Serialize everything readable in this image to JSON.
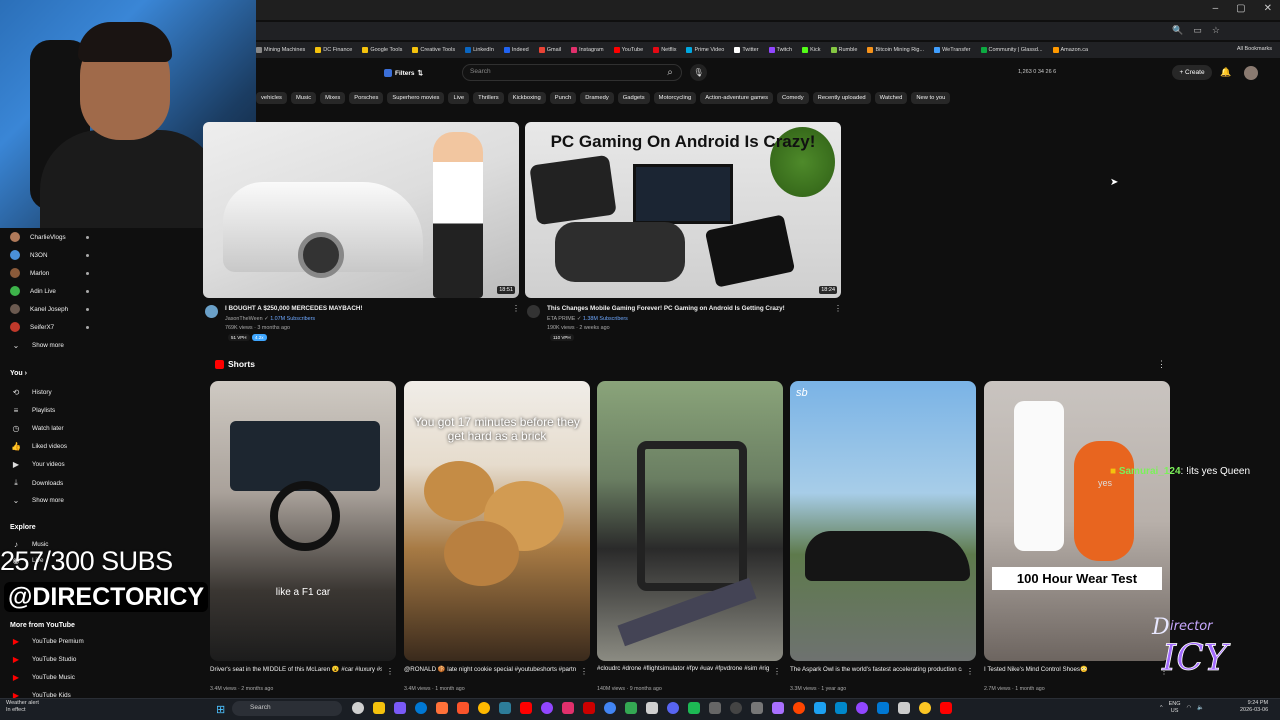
{
  "browser": {
    "window_controls": [
      "–",
      "▢",
      "✕"
    ],
    "bookmarks": [
      {
        "label": "Mining Machines",
        "color": "#888888"
      },
      {
        "label": "DC Finance",
        "color": "#f4c20d"
      },
      {
        "label": "Google Tools",
        "color": "#f4c20d"
      },
      {
        "label": "Creative Tools",
        "color": "#f4c20d"
      },
      {
        "label": "LinkedIn",
        "color": "#0a66c2"
      },
      {
        "label": "Indeed",
        "color": "#2164f3"
      },
      {
        "label": "Gmail",
        "color": "#ea4335"
      },
      {
        "label": "Instagram",
        "color": "#e1306c"
      },
      {
        "label": "YouTube",
        "color": "#ff0000"
      },
      {
        "label": "Netflix",
        "color": "#e50914"
      },
      {
        "label": "Prime Video",
        "color": "#00a8e1"
      },
      {
        "label": "Twitter",
        "color": "#ffffff"
      },
      {
        "label": "Twitch",
        "color": "#9146ff"
      },
      {
        "label": "Kick",
        "color": "#53fc18"
      },
      {
        "label": "Rumble",
        "color": "#85c742"
      },
      {
        "label": "Bitcoin Mining Rig...",
        "color": "#f7931a"
      },
      {
        "label": "WeTransfer",
        "color": "#409fff"
      },
      {
        "label": "Community | Glassd...",
        "color": "#0caa41"
      },
      {
        "label": "Amazon.ca",
        "color": "#ff9900"
      }
    ],
    "all_bookmarks": "All Bookmarks"
  },
  "topbar": {
    "filters": "Filters",
    "search_placeholder": "Search",
    "stats": "1,263  0  34  26  6",
    "create": "Create"
  },
  "chips": [
    "vehicles",
    "Music",
    "Mixes",
    "Porsches",
    "Superhero movies",
    "Live",
    "Thrillers",
    "Kickboxing",
    "Punch",
    "Dramedy",
    "Gadgets",
    "Motorcycling",
    "Action-adventure games",
    "Comedy",
    "Recently uploaded",
    "Watched",
    "New to you"
  ],
  "sidebar": {
    "subscriptions": [
      {
        "name": "CharlieVlogs",
        "color": "#b07a5a"
      },
      {
        "name": "N3ON",
        "color": "#4a90d9"
      },
      {
        "name": "Marlon",
        "color": "#8a5a3a"
      },
      {
        "name": "Adin Live",
        "color": "#3db34a"
      },
      {
        "name": "Kanel Joseph",
        "color": "#6b5a50"
      },
      {
        "name": "SeiferX7",
        "color": "#c0392b"
      }
    ],
    "show_more_1": "Show more",
    "you_heading": "You",
    "you_items": [
      {
        "label": "History",
        "icon": "⟲"
      },
      {
        "label": "Playlists",
        "icon": "≡"
      },
      {
        "label": "Watch later",
        "icon": "◷"
      },
      {
        "label": "Liked videos",
        "icon": "👍"
      },
      {
        "label": "Your videos",
        "icon": "▶"
      },
      {
        "label": "Downloads",
        "icon": "⤓"
      }
    ],
    "show_more_2": "Show more",
    "explore_heading": "Explore",
    "explore_items": [
      {
        "label": "Music",
        "icon": "♪"
      },
      {
        "label": "Live",
        "icon": "◉"
      }
    ],
    "more_heading": "More from YouTube",
    "more_items": [
      {
        "label": "YouTube Premium",
        "color": "#ff0000"
      },
      {
        "label": "YouTube Studio",
        "color": "#ff0000"
      },
      {
        "label": "YouTube Music",
        "color": "#ff0000"
      },
      {
        "label": "YouTube Kids",
        "color": "#ff0000"
      }
    ]
  },
  "overlay": {
    "subs": "257/300 SUBS",
    "handle": "@DIRECTORICY"
  },
  "videos": [
    {
      "title": "I BOUGHT A $250,000 MERCEDES MAYBACH!",
      "channel": "JasonTheWeen",
      "subs": "1.07M Subscribers",
      "meta": "769K views · 3 months ago",
      "vph": "51 VPH",
      "vph2": "4.2x",
      "duration": "18:51"
    },
    {
      "title": "This Changes Mobile Gaming Forever! PC Gaming on Android Is Getting Crazy!",
      "channel": "ETA PRIME",
      "subs": "1.38M Subscribers",
      "meta": "190K views · 2 weeks ago",
      "vph": "110 VPH",
      "duration": "18:24",
      "thumb_text": "PC Gaming On Android Is Crazy!"
    }
  ],
  "shorts_heading": "Shorts",
  "shorts": [
    {
      "title": "Driver's seat in the MIDDLE of this McLaren 😮 #car #luxury #supercars",
      "views": "3.4M views",
      "age": "2 months ago",
      "caption": "like a F1 car"
    },
    {
      "title": "@RONALD 🍪 late night cookie special #youtubeshorts #partnership #brand #shorts #sho...",
      "views": "3.4M views",
      "age": "1 month ago",
      "caption": "You got 17 minutes before they get hard as a brick"
    },
    {
      "title": "#cloudrc #drone #flightsimulator #fpv #uav #fpvdrone #sim #rig #simulator",
      "views": "140M views",
      "age": "9 months ago",
      "caption": ""
    },
    {
      "title": "The Aspark Owl is the world's fastest accelerating production car... 🔥 Available now on @sbxcars!",
      "views": "3.3M views",
      "age": "1 year ago",
      "caption": ""
    },
    {
      "title": "I Tested Nike's Mind Control Shoes😳",
      "views": "2.7M views",
      "age": "1 month ago",
      "caption": "100 Hour Wear Test"
    }
  ],
  "chat": {
    "user": "Samurai_124",
    "message": ": !its yes Queen",
    "sub": "yes"
  },
  "logo_text": "DIRECTOR ICY",
  "taskbar": {
    "weather_title": "Weather alert",
    "weather_sub": "In effect",
    "search": "Search",
    "lang": "ENG",
    "region": "US",
    "time": "9:24 PM",
    "date": "2026-03-06",
    "app_colors": [
      "#cfcfcf",
      "#f4c20d",
      "#7a5af8",
      "#0078d4",
      "#ff7139",
      "#fb542b",
      "#ffb900",
      "#2d7d9a",
      "#ff0000",
      "#9146ff",
      "#e1306c",
      "#c00",
      "#4285f4",
      "#34a853",
      "#cfcfcf",
      "#5865f2",
      "#1db954",
      "#666",
      "#444",
      "#777",
      "#a970ff",
      "#ff4500",
      "#1da1f2",
      "#0088cc",
      "#9146ff",
      "#0078d4",
      "#ccc",
      "#fcc624",
      "#ff0000"
    ]
  }
}
